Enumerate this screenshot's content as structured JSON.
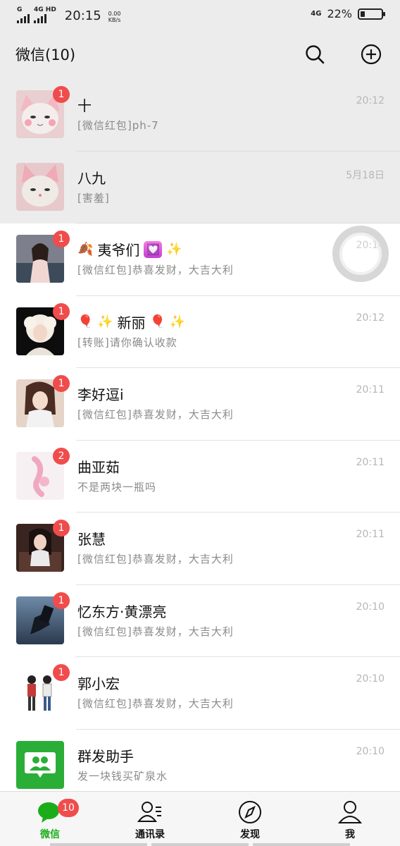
{
  "statusbar": {
    "sim1_type": "G",
    "sim2_type": "4G HD",
    "time": "20:15",
    "speed_value": "0.00",
    "speed_unit": "KB/s",
    "network_right": "4G",
    "battery_percent": "22%",
    "battery_level": 0.22
  },
  "header": {
    "title": "微信(10)",
    "search_icon": "search-icon",
    "add_icon": "plus-circle-icon"
  },
  "chats": [
    {
      "name": "十",
      "preview": "[微信红包]ph-7",
      "time": "20:12",
      "badge": "1",
      "pinned": true
    },
    {
      "name": "八九",
      "preview": "[害羞]",
      "time": "5月18日",
      "badge": "",
      "pinned": true
    },
    {
      "name_emoji_left": "🍂",
      "name": "夷爷们",
      "name_emoji_right": "✨",
      "heart": "💟",
      "preview": "[微信红包]恭喜发财，大吉大利",
      "time": "20:14",
      "badge": "1",
      "pinned": false
    },
    {
      "name_emoji_left": "🎈 ✨",
      "name": "新丽",
      "name_emoji_right": "🎈 ✨",
      "preview": "[转账]请你确认收款",
      "time": "20:12",
      "badge": "1",
      "pinned": false
    },
    {
      "name": "李好逗i",
      "preview": "[微信红包]恭喜发财，大吉大利",
      "time": "20:11",
      "badge": "1",
      "pinned": false
    },
    {
      "name": "曲亚茹",
      "preview": "不是两块一瓶吗",
      "time": "20:11",
      "badge": "2",
      "pinned": false
    },
    {
      "name": "张慧",
      "preview": "[微信红包]恭喜发财，大吉大利",
      "time": "20:11",
      "badge": "1",
      "pinned": false
    },
    {
      "name": "忆东方·黄漂亮",
      "preview": "[微信红包]恭喜发财，大吉大利",
      "time": "20:10",
      "badge": "1",
      "pinned": false
    },
    {
      "name": "郭小宏",
      "preview": "[微信红包]恭喜发财，大吉大利",
      "time": "20:10",
      "badge": "1",
      "pinned": false
    },
    {
      "name": "群发助手",
      "preview": "发一块钱买矿泉水",
      "time": "20:10",
      "badge": "",
      "pinned": false
    }
  ],
  "tabs": [
    {
      "label": "微信",
      "badge": "10",
      "icon": "chat-bubbles-icon",
      "active": true
    },
    {
      "label": "通讯录",
      "icon": "contacts-icon",
      "active": false
    },
    {
      "label": "发现",
      "icon": "compass-icon",
      "active": false
    },
    {
      "label": "我",
      "icon": "person-icon",
      "active": false
    }
  ],
  "colors": {
    "accent_green": "#1aad19",
    "badge_red": "#f04c4c",
    "header_bg": "#ececec"
  }
}
